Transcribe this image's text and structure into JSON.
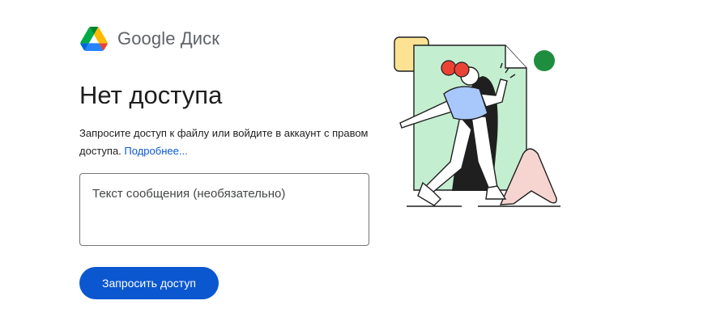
{
  "header": {
    "brand": "Google Диск",
    "logo_icon": "google-drive-logo-icon",
    "logo_colors": [
      "#0066da",
      "#00ac47",
      "#ea4335",
      "#00832d",
      "#2684fc",
      "#ffba00"
    ]
  },
  "main": {
    "title": "Нет доступа",
    "description": "Запросите доступ к файлу или войдите в аккаунт с правом доступа. ",
    "learn_more_link": "Подробнее...",
    "message_placeholder": "Текст сообщения (необязательно)",
    "message_value": "",
    "request_button": "Запросить доступ"
  },
  "illustration": {
    "icon": "person-running-out-of-document-illustration",
    "colors": {
      "document": "#c4eed0",
      "square": "#fde293",
      "dot": "#1e8e3e",
      "triangle": "#f6d5d1",
      "hair": "#ea4335",
      "shirt": "#a8c7fa",
      "accent_button": "#0b57d0"
    }
  }
}
